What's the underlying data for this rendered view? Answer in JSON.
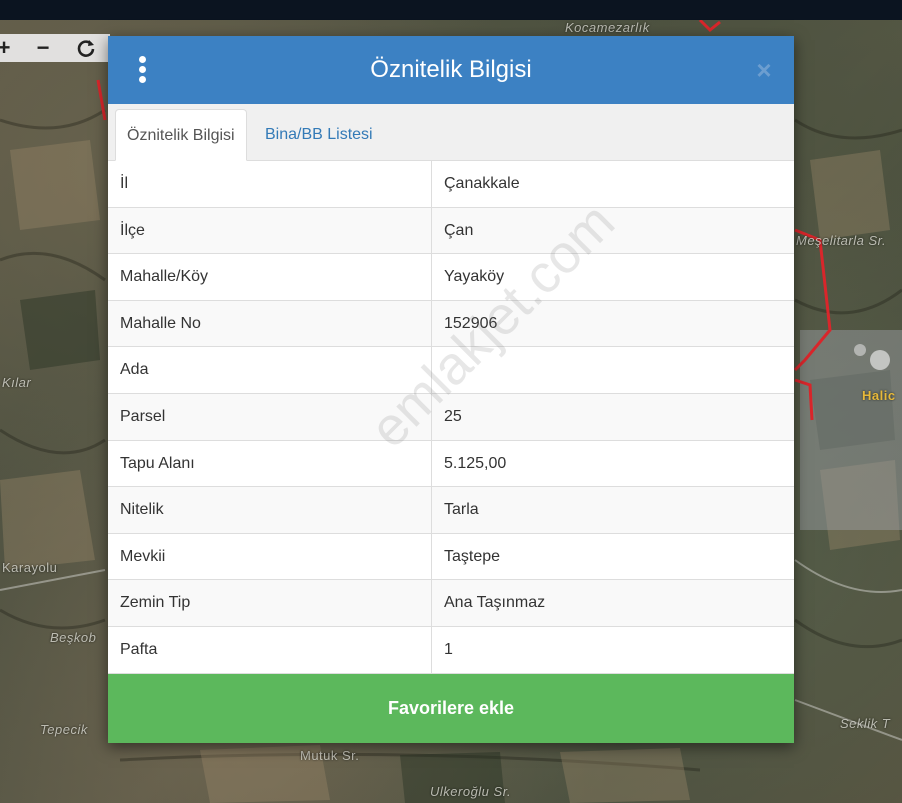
{
  "map": {
    "labels": [
      "Kocamezarlık",
      "Kılar",
      "Karayolu",
      "Beşkob",
      "Tepecik",
      "Mutuk Sr.",
      "Ulkeroğlu Sr.",
      "Meşelitarla Sr.",
      "Halic",
      "Seklik T"
    ]
  },
  "modal": {
    "title": "Öznitelik Bilgisi",
    "close_label": "×",
    "tabs": [
      {
        "label": "Öznitelik Bilgisi",
        "active": true
      },
      {
        "label": "Bina/BB Listesi",
        "active": false
      }
    ],
    "rows": [
      {
        "key": "İl",
        "value": "Çanakkale"
      },
      {
        "key": "İlçe",
        "value": "Çan"
      },
      {
        "key": "Mahalle/Köy",
        "value": "Yayaköy"
      },
      {
        "key": "Mahalle No",
        "value": "152906"
      },
      {
        "key": "Ada",
        "value": ""
      },
      {
        "key": "Parsel",
        "value": "25"
      },
      {
        "key": "Tapu Alanı",
        "value": "5.125,00"
      },
      {
        "key": "Nitelik",
        "value": "Tarla"
      },
      {
        "key": "Mevkii",
        "value": "Taştepe"
      },
      {
        "key": "Zemin Tip",
        "value": "Ana Taşınmaz"
      },
      {
        "key": "Pafta",
        "value": "1"
      }
    ],
    "favorite_button": "Favorilere ekle",
    "watermark": "emlakjet.com"
  },
  "colors": {
    "header": "#3c81c3",
    "favorite_button": "#5cb85c",
    "tab_link": "#337ab7",
    "parcel_border": "#d9262b"
  },
  "icons": [
    "zoom-in-icon",
    "zoom-out-icon",
    "refresh-icon",
    "kebab-menu-icon",
    "close-icon"
  ]
}
